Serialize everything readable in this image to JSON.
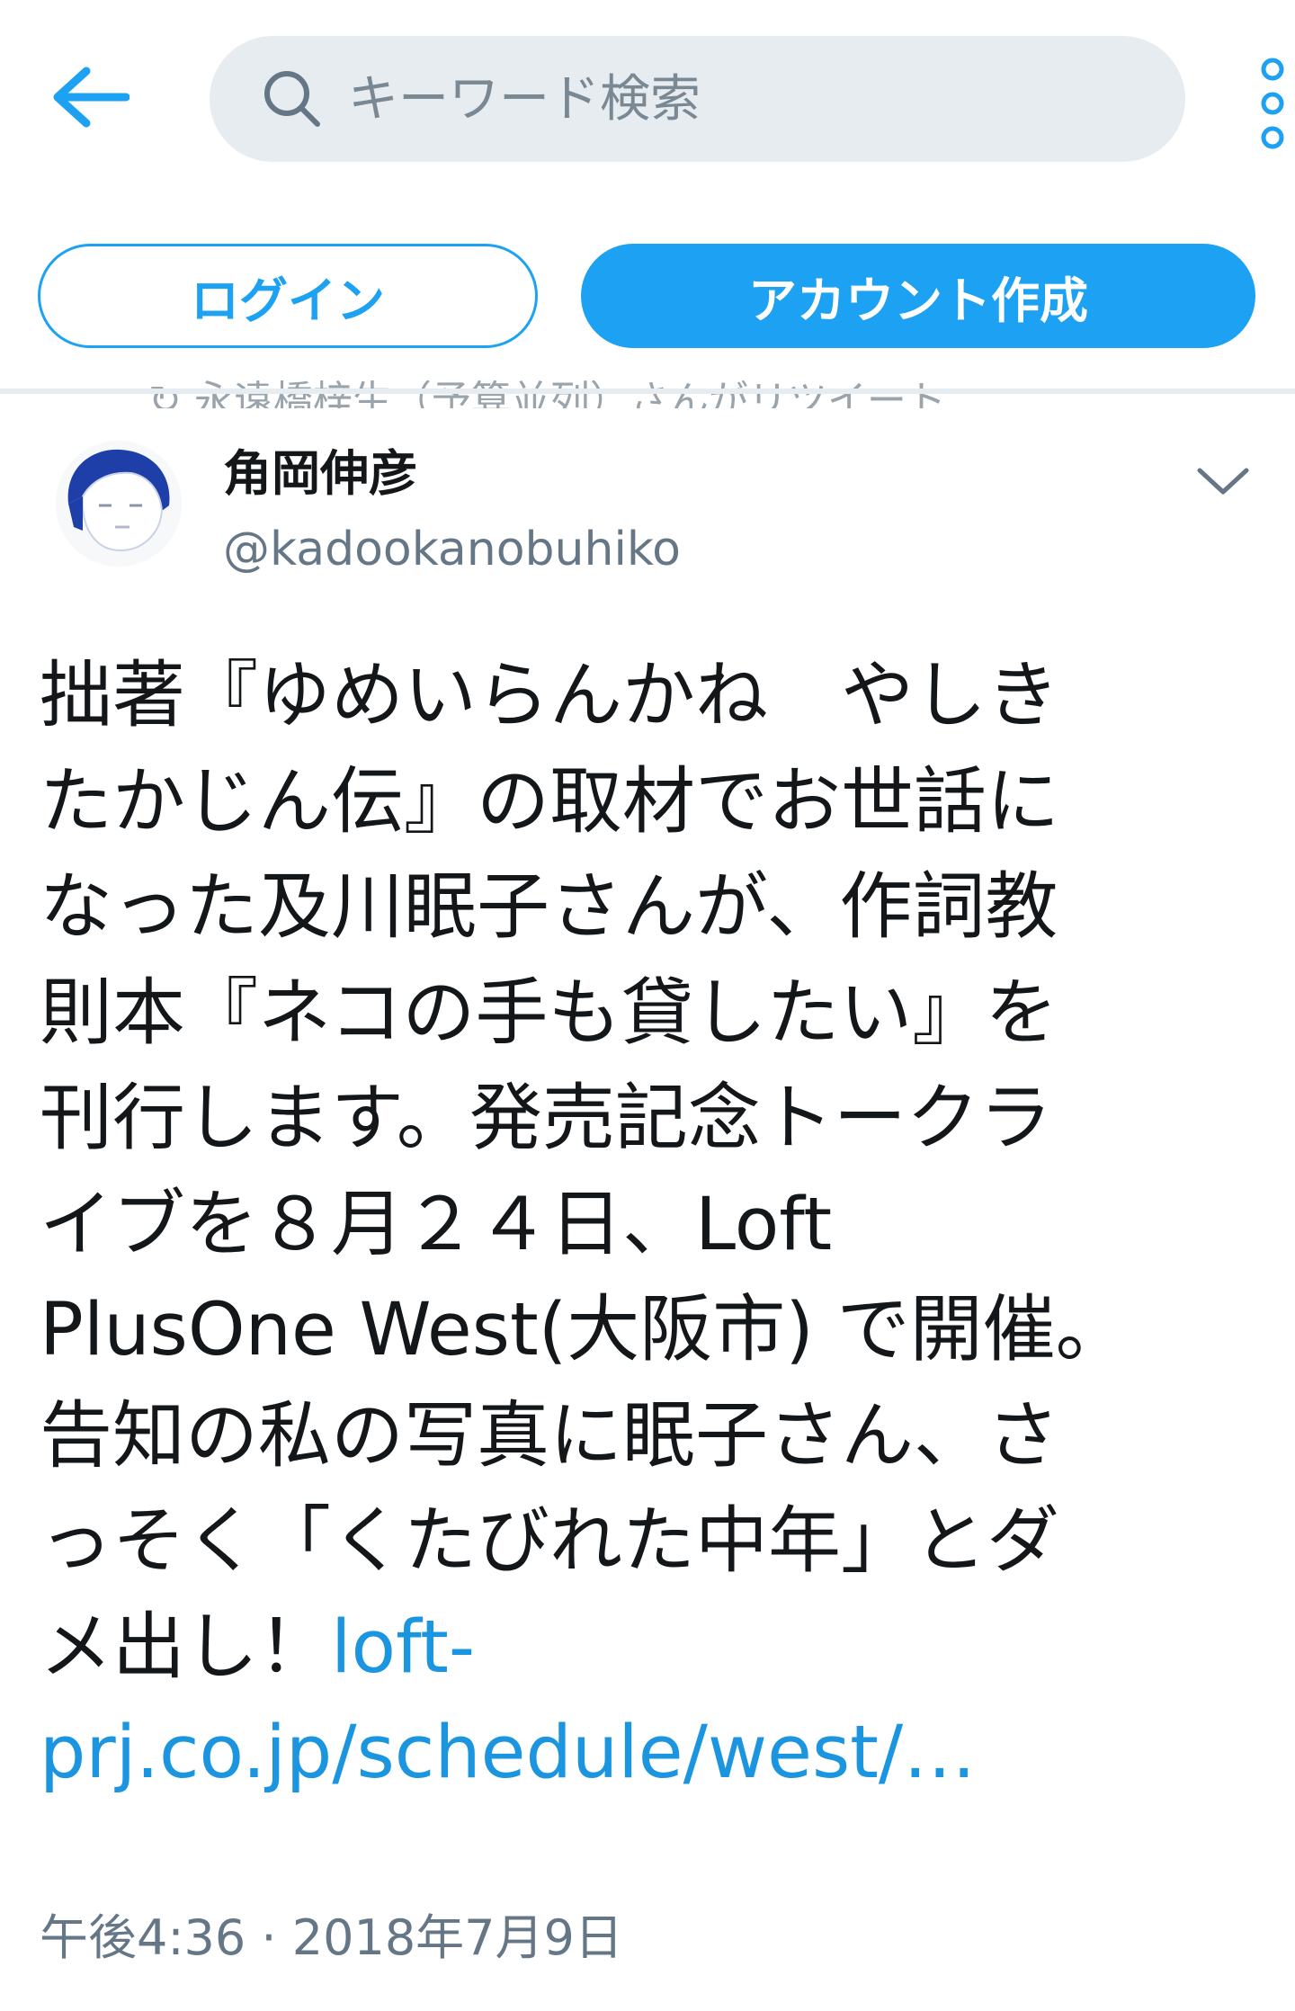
{
  "colors": {
    "accent": "#1da1f2",
    "link": "#1b95e0",
    "text_primary": "#14171a",
    "text_secondary": "#657786",
    "search_bg": "#e6ecf0"
  },
  "header": {
    "back_icon": "arrow-left-icon",
    "search": {
      "icon": "search-icon",
      "placeholder": "キーワード検索"
    },
    "more_icon": "vertical-dots-icon"
  },
  "auth": {
    "login_label": "ログイン",
    "signup_label": "アカウント作成"
  },
  "previous_tweet": {
    "context_text": "↻ 永遠橋梓生（予算並列）さんがリツイート"
  },
  "tweet": {
    "author_name": "角岡伸彦",
    "author_handle": "@kadookanobuhiko",
    "caret_icon": "chevron-down-icon",
    "text_lines": "拙著『ゆめいらんかね　やしき\nたかじん伝』の取材でお世話に\nなった及川眠子さんが、作詞教\n則本『ネコの手も貸したい』を\n刊行します。発売記念トークラ\nイブを８月２４日、Loft\nPlusOne West(大阪市) で開催。\n告知の私の写真に眠子さん、さ\nっそく「くたびれた中年」とダ\nメ出し！",
    "link_text": "loft-\nprj.co.jp/schedule/west/…",
    "timestamp": "午後4:36 · 2018年7月9日"
  }
}
